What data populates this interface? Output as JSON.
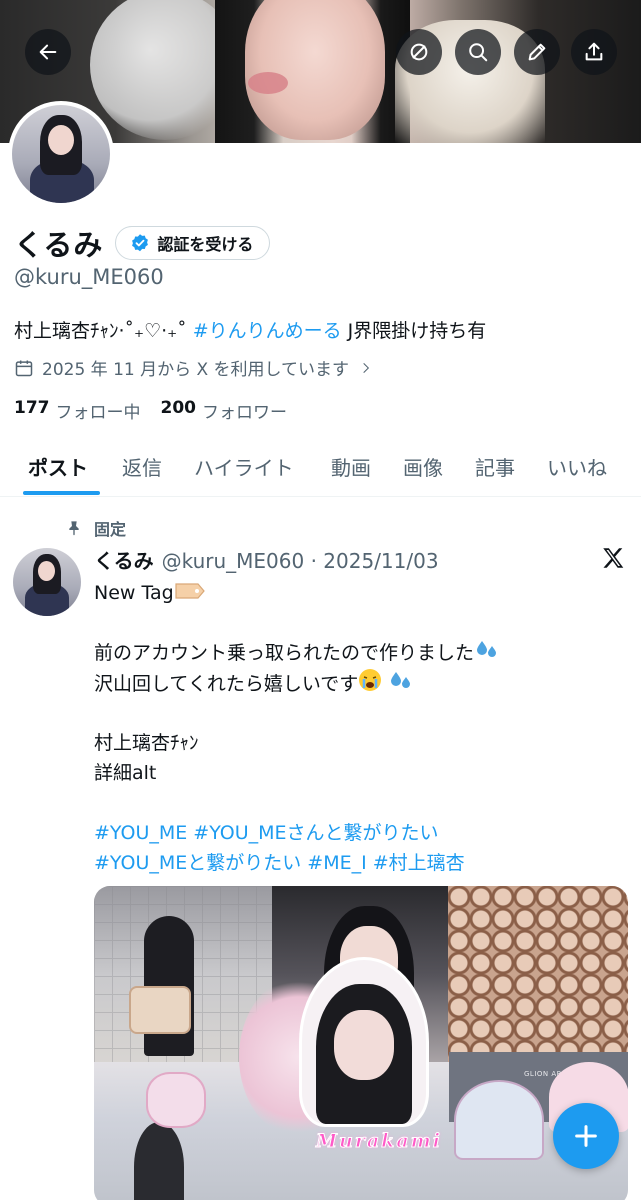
{
  "header": {
    "back_icon": "arrow-left-icon",
    "actions": [
      {
        "name": "grok-icon"
      },
      {
        "name": "search-icon"
      },
      {
        "name": "edit-icon"
      },
      {
        "name": "share-icon"
      }
    ]
  },
  "profile": {
    "display_name": "くるみ",
    "verify_button_label": "認証を受ける",
    "handle": "@kuru_ME060",
    "bio_prefix": "村上璃杏ﾁｬﾝ‧˚₊♡‧₊˚",
    "bio_hashtag": "#りんりんめーる",
    "bio_suffix": " J界隈掛け持ち有",
    "joined_text": "2025 年 11 月から X を利用しています",
    "following_count": "177",
    "following_label": "フォロー中",
    "followers_count": "200",
    "followers_label": "フォロワー"
  },
  "tabs": [
    "ポスト",
    "返信",
    "ハイライト",
    "動画",
    "画像",
    "記事",
    "いいね"
  ],
  "active_tab": "ポスト",
  "post": {
    "pinned_label": "固定",
    "author_name": "くるみ",
    "author_handle_date": "@kuru_ME060 · 2025/11/03",
    "lines": [
      "New Tag",
      "",
      "前のアカウント乗っ取られたので作りました",
      "沢山回してくれたら嬉しいです",
      "",
      "村上璃杏ﾁｬﾝ",
      "詳細alt",
      ""
    ],
    "hashtag_lines": [
      " #YOU_ME  #YOU_MEさんと繋がりたい",
      "#YOU_MEと繋がりたい  #ME_I  #村上璃杏"
    ],
    "image_caption": "Murakami",
    "stadium_sign": "GLION ARENA KOBE"
  },
  "colors": {
    "accent": "#1d9bf0",
    "text_primary": "#0f1419",
    "text_secondary": "#536471"
  },
  "fab_icon": "plus-icon"
}
